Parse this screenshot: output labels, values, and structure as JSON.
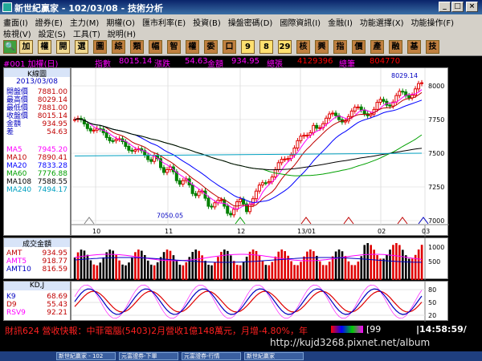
{
  "window": {
    "title": "新世紀贏家 - 102/03/08 - 技術分析"
  },
  "menu": {
    "row1": [
      "畫面(I)",
      "證券(E)",
      "主力(M)",
      "期權(O)",
      "匯市利率(E)",
      "投資(B)",
      "操盤密碼(D)",
      "國際資訊(I)",
      "金融(I)",
      "功能選擇(X)",
      "功能操作(F)"
    ],
    "row2": [
      "檢視(V)",
      "設定(S)",
      "工具(T)",
      "說明(H)"
    ]
  },
  "toolbar": {
    "buttons": [
      "加",
      "權",
      "開",
      "選",
      "圖",
      "綜",
      "類",
      "幅",
      "智",
      "權",
      "委",
      "口",
      "9",
      "8",
      "29",
      "核",
      "興",
      "指",
      "價",
      "產",
      "融",
      "基",
      "技"
    ]
  },
  "info": {
    "code": "#001 加權(日)",
    "index_label": "指數",
    "index_value": "8015.14",
    "change_label": "漲跌",
    "change_value": "54.63",
    "amount_label": "金額",
    "amount_value": "934.95",
    "vol_label": "總張",
    "vol_value": "4129396",
    "trades_label": "總筆",
    "trades_value": "804770"
  },
  "kpanel": {
    "title": "K線圖",
    "date": "2013/03/08",
    "rows": [
      {
        "label": "開盤價",
        "value": "7881.00"
      },
      {
        "label": "最高價",
        "value": "8029.14"
      },
      {
        "label": "最低價",
        "value": "7881.00"
      },
      {
        "label": "收盤價",
        "value": "8015.14"
      },
      {
        "label": "金額",
        "value": "934.95"
      },
      {
        "label": "差",
        "value": "54.63"
      }
    ],
    "ma": [
      {
        "label": "MA5",
        "value": "7945.20",
        "color": "#ff00ff"
      },
      {
        "label": "MA10",
        "value": "7890.41",
        "color": "#c00000"
      },
      {
        "label": "MA20",
        "value": "7833.28",
        "color": "#0000ff"
      },
      {
        "label": "MA60",
        "value": "7776.88",
        "color": "#00a000"
      },
      {
        "label": "MA108",
        "value": "7588.55",
        "color": "#000000"
      },
      {
        "label": "MA240",
        "value": "7494.17",
        "color": "#00a0c0"
      }
    ]
  },
  "volpanel": {
    "title": "成交金額",
    "rows": [
      {
        "label": "AMT",
        "value": "934.95"
      },
      {
        "label": "AMT5",
        "value": "918.77"
      },
      {
        "label": "AMT10",
        "value": "816.59"
      }
    ],
    "ticks": [
      "1000",
      "500"
    ]
  },
  "kdpanel": {
    "title": "KD,J",
    "rows": [
      {
        "label": "K9",
        "value": "68.69"
      },
      {
        "label": "D9",
        "value": "55.43"
      },
      {
        "label": "RSV9",
        "value": "92.21"
      }
    ],
    "ticks": [
      "80",
      "50",
      "20"
    ]
  },
  "chart": {
    "max_label": "8029.14",
    "min_label": "7050.05",
    "y_ticks": [
      "8000",
      "7750",
      "7500",
      "7250",
      "7000"
    ],
    "x_ticks": [
      "10",
      "11",
      "12",
      "13/01",
      "02",
      "03"
    ],
    "vline_label": "10"
  },
  "status": {
    "ticker": "財訊624 營收快報：中菲電腦(5403)2月營收1億148萬元，月增-4.80%，年",
    "code": "99",
    "time": "14:58:59/"
  },
  "url": "http://kujd3268.pixnet.net/album",
  "taskbar": [
    "新世紀贏家 - 102",
    "元富證券-下單",
    "元富證券-行情",
    "新世紀贏家"
  ]
}
